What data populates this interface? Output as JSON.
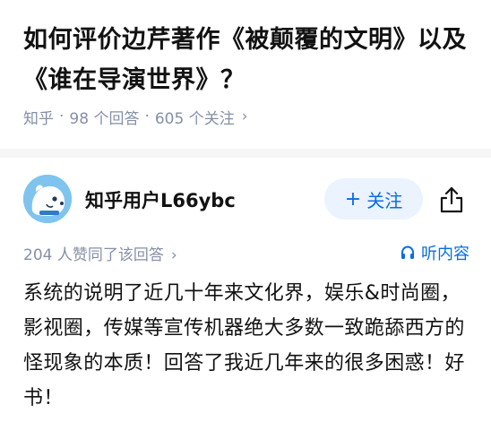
{
  "question": {
    "title": "如何评价边芹著作《被颠覆的文明》以及《谁在导演世界》？",
    "source": "知乎",
    "answers_count": "98 个回答",
    "followers_count": "605 个关注",
    "separator": "·",
    "chevron": "›"
  },
  "answer": {
    "author_name": "知乎用户L66ybc",
    "follow_label": "关注",
    "follow_plus": "+",
    "vote_text": "204 人赞同了该回答",
    "vote_chevron": "›",
    "listen_label": "听内容",
    "content": "系统的说明了近几十年来文化界，娱乐&时尚圈，影视圈，传媒等宣传机器绝大多数一致跪舔西方的怪现象的本质！回答了我近几年来的很多困惑！好书！"
  },
  "icons": {
    "avatar": "zhihu-default-avatar",
    "share": "share-icon",
    "listen": "headphones-icon"
  },
  "colors": {
    "brand_blue": "#056de8",
    "follow_bg": "#ebf3ff",
    "meta_gray": "#8590a6",
    "avatar_bg": "#7fc4ee",
    "divider": "#f6f6f6"
  }
}
